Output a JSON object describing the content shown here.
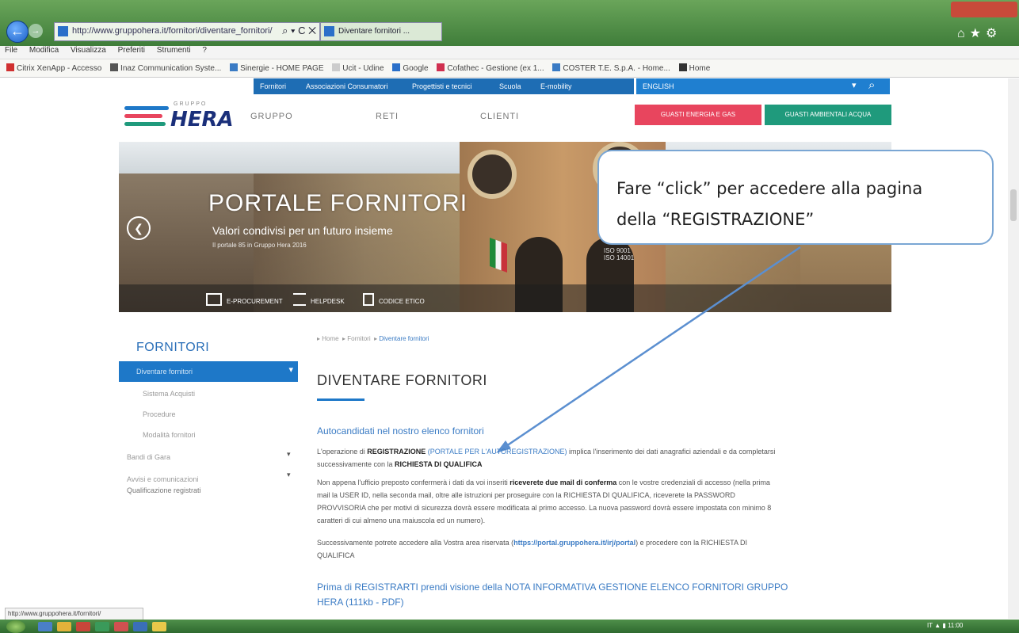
{
  "browser": {
    "url": "http://www.gruppohera.it/fornitori/diventare_fornitori/",
    "address_controls": "⌕ ▾ C ✕",
    "tab_title": "Diventare fornitori ...",
    "menu": [
      "File",
      "Modifica",
      "Visualizza",
      "Preferiti",
      "Strumenti",
      "?"
    ],
    "favorites": [
      {
        "label": "Citrix XenApp - Accesso",
        "color": "#d03030"
      },
      {
        "label": "Inaz Communication Syste...",
        "color": "#555555"
      },
      {
        "label": "Sinergie - HOME PAGE",
        "color": "#3a7bc4"
      },
      {
        "label": "Ucit - Udine",
        "color": "#cccccc"
      },
      {
        "label": "Google",
        "color": "#2a6fc9"
      },
      {
        "label": "Cofathec - Gestione (ex 1...",
        "color": "#d03050"
      },
      {
        "label": "COSTER T.E. S.p.A. - Home...",
        "color": "#3a7bc4"
      },
      {
        "label": "Home",
        "color": "#333333"
      }
    ],
    "status_url": "http://www.gruppohera.it/fornitori/"
  },
  "site": {
    "topnav": [
      "Fornitori",
      "Associazioni Consumatori",
      "Progettisti e tecnici",
      "Scuola",
      "E-mobility"
    ],
    "lang": "ENGLISH",
    "logo_gruppo": "GRUPPO",
    "logo_text": "HERA",
    "mainnav": [
      "GRUPPO",
      "RETI",
      "CLIENTI"
    ],
    "btn_red": "GUASTI ENERGIA E GAS",
    "btn_green": "GUASTI AMBIENTALI ACQUA",
    "logo_colors": [
      "#1e78c8",
      "#e8455e",
      "#1f9a7c"
    ]
  },
  "hero": {
    "title": "PORTALE FORNITORI",
    "subtitle": "Valori condivisi per un futuro insieme",
    "small": "Il portale 85 in Gruppo Hera 2016",
    "right1": "ISO 9001",
    "right2": "ISO 14001",
    "band": [
      "E-PROCUREMENT",
      "HELPDESK",
      "CODICE ETICO"
    ]
  },
  "callout": {
    "line1": "Fare “click” per accedere alla pagina",
    "line2": "della “REGISTRAZIONE”"
  },
  "sidebar": {
    "title": "FORNITORI",
    "active": "Diventare fornitori",
    "items": [
      "Sistema Acquisti",
      "Procedure",
      "Modalità fornitori",
      "Bandi di Gara",
      "Avvisi e comunicazioni",
      "Qualificazione registrati"
    ]
  },
  "content": {
    "breadcrumb": [
      "Home",
      "Fornitori",
      "Diventare fornitori"
    ],
    "title": "DIVENTARE FORNITORI",
    "sub1": "Autocandidati nel nostro elenco fornitori",
    "p1_a": "L'operazione di ",
    "p1_b": "REGISTRAZIONE",
    "p1_link": " (PORTALE PER L'AUTOREGISTRAZIONE)",
    "p1_c": " implica l'inserimento dei dati anagrafici aziendali e da completarsi",
    "p1_d": "successivamente con la ",
    "p1_e": "RICHIESTA DI QUALIFICA",
    "p2_l1a": "Non appena l'ufficio preposto confermerà i dati da voi inseriti ",
    "p2_l1b": "riceverete due mail di conferma",
    "p2_l1c": " con le vostre credenziali di accesso (nella prima",
    "p2_l2": "mail la USER ID, nella seconda mail, oltre alle istruzioni per proseguire con la RICHIESTA DI QUALIFICA, riceverete la PASSWORD",
    "p2_l3": "PROVVISORIA che per motivi di sicurezza dovrà essere modificata al primo accesso. La nuova password dovrà essere impostata con minimo 8",
    "p2_l4": "caratteri di cui almeno una maiuscola ed un numero).",
    "p3_a": "Successivamente potrete accedere alla Vostra area riservata (",
    "p3_b": "https://portal.gruppohera.it/irj/portal",
    "p3_c": ") e procedere con la RICHIESTA DI",
    "p3_d": "QUALIFICA",
    "sub2_l1": "Prima di REGISTRARTI prendi visione della NOTA INFORMATIVA GESTIONE ELENCO FORNITORI GRUPPO",
    "sub2_l2": "HERA (111kb - PDF)"
  },
  "tray": "IT  ▲  ▮  11:00",
  "arrow_color": "#5b8fd0"
}
